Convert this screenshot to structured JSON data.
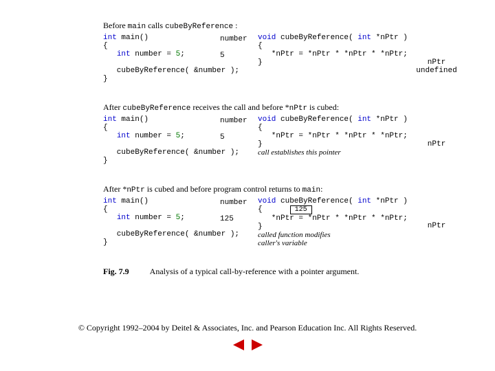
{
  "stage1": {
    "header_before": "Before",
    "header_calls": " calls ",
    "header_colon": ":",
    "main_sig": "main",
    "func_sig": "cubeByReference",
    "number_label": "number",
    "number_val": "5",
    "nptr_label": "nPtr",
    "nptr_val": "undefined"
  },
  "stage2": {
    "header_after": "After ",
    "header_receives": " receives the call and before *",
    "header_cubed": " is cubed:",
    "number_val": "5",
    "note": "call establishes this pointer"
  },
  "stage3": {
    "header_after": "After *",
    "header_mid": " is cubed and before program control returns to ",
    "header_colon": ":",
    "number_val": "125",
    "result_box": "125",
    "note1": "called function modifies",
    "note2": "caller's variable"
  },
  "code": {
    "kw_int": "int",
    "kw_void": "void",
    "main_open": " main()",
    "lbrace": "{",
    "rbrace": "}",
    "decl_pre": "   ",
    "decl_mid": " number = ",
    "lit5": "5",
    "semi": ";",
    "call": "   cubeByReference( &number );",
    "fn_pre": " cubeByReference( ",
    "fn_ptr": " *nPtr )",
    "body": "   *nPtr = *nPtr * *nPtr * *nPtr;"
  },
  "caption_label": "Fig. 7.9",
  "caption_text": "Analysis of a typical call-by-reference with a pointer argument.",
  "copyright": "© Copyright 1992–2004 by Deitel & Associates, Inc. and Pearson Education Inc. All Rights Reserved."
}
